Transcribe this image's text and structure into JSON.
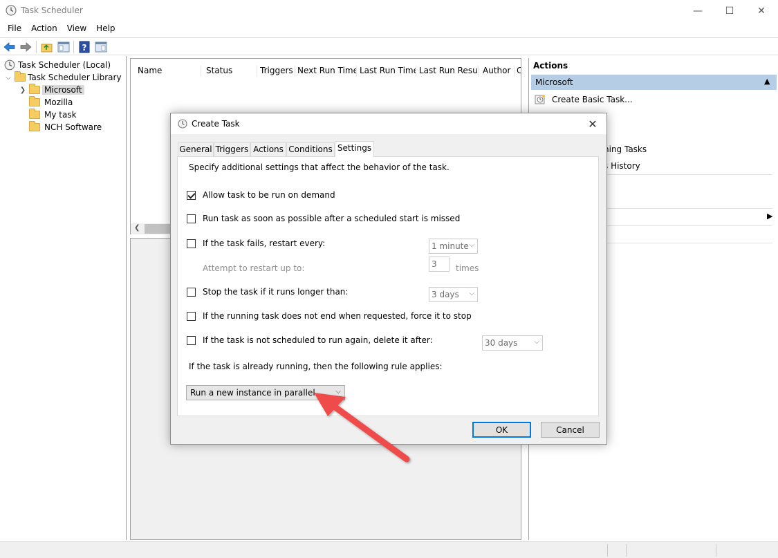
{
  "window": {
    "title": "Task Scheduler",
    "controls": {
      "minimize": "—",
      "maximize": "☐",
      "close": "✕"
    }
  },
  "menu": [
    "File",
    "Action",
    "View",
    "Help"
  ],
  "toolbar": {
    "icons": [
      "back-arrow-icon",
      "forward-arrow-icon",
      "folder-up-icon",
      "show-hide-console-tree-icon",
      "help-icon",
      "show-hide-action-pane-icon"
    ]
  },
  "tree": {
    "root": "Task Scheduler (Local)",
    "library": "Task Scheduler Library",
    "folders": [
      "Microsoft",
      "Mozilla",
      "My task",
      "NCH Software"
    ],
    "selected": "Microsoft"
  },
  "list": {
    "columns": [
      "Name",
      "Status",
      "Triggers",
      "Next Run Time",
      "Last Run Time",
      "Last Run Result",
      "Author",
      "C"
    ],
    "scroll_left_glyph": "❮"
  },
  "actions": {
    "title": "Actions",
    "section": "Microsoft",
    "section_caret": "▲",
    "items": [
      "Create Basic Task...",
      "ning Tasks",
      "s History"
    ],
    "submenu_caret": "▶"
  },
  "dialog": {
    "title": "Create Task",
    "close_glyph": "✕",
    "tabs": [
      "General",
      "Triggers",
      "Actions",
      "Conditions",
      "Settings"
    ],
    "active_tab": "Settings",
    "intro": "Specify additional settings that affect the behavior of the task.",
    "options": {
      "allow_on_demand": {
        "label": "Allow task to be run on demand",
        "checked": true
      },
      "run_asap": {
        "label": "Run task as soon as possible after a scheduled start is missed",
        "checked": false
      },
      "restart_every": {
        "label": "If the task fails, restart every:",
        "checked": false,
        "value": "1 minute"
      },
      "attempt_restart": {
        "label": "Attempt to restart up to:",
        "value": "3",
        "unit": "times"
      },
      "stop_longer": {
        "label": "Stop the task if it runs longer than:",
        "checked": false,
        "value": "3 days"
      },
      "force_stop": {
        "label": "If the running task does not end when requested, force it to stop",
        "checked": false
      },
      "delete_after": {
        "label": "If the task is not scheduled to run again, delete it after:",
        "checked": false,
        "value": "30 days"
      }
    },
    "rule_label": "If the task is already running, then the following rule applies:",
    "rule_value": "Run a new instance in parallel",
    "caret": "⌵",
    "ok": "OK",
    "cancel": "Cancel"
  },
  "colors": {
    "accent": "#0078d7",
    "section_bg": "#b6cde6",
    "arrow": "#ef4b4b"
  }
}
